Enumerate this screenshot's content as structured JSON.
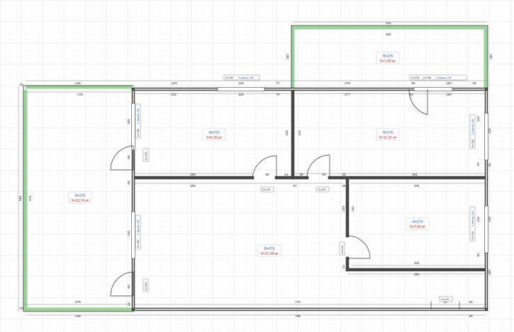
{
  "colors": {
    "grid_minor": "#eef1f5",
    "grid_major": "#d6dce6",
    "wall": "#444444",
    "exterior_wall": "#9bd49b",
    "room_height_text": "#1a5fb4",
    "room_area_text": "#c0262d"
  },
  "rooms": {
    "big_left": {
      "height": "H=270",
      "area": "S=15,74 м²"
    },
    "room_mid_top": {
      "height": "H=270",
      "area": "S=8,90 м²"
    },
    "room_right_top": {
      "height": "H=270",
      "area": "S=11,32 м²"
    },
    "room_top_annex": {
      "height": "H=270",
      "area": "S=7,40 м²"
    },
    "room_center": {
      "height": "H=270",
      "area": "S=21,08 м²"
    },
    "room_right_mid": {
      "height": "H=270",
      "area": "S=7,68 м²"
    }
  },
  "dimensions": {
    "top_total_left": "246",
    "top_left_inner": "276",
    "top_224": "224",
    "top_214": "214",
    "top_120a": "120",
    "top_120b": "120",
    "top_77": "77",
    "top_75": "75",
    "top_275": "275",
    "top_277": "277",
    "top_90": "90",
    "top_100a": "100",
    "top_100b": "100",
    "top_36": "36",
    "top_90b": "90",
    "annex_511": "511",
    "annex_491": "491",
    "annex_left": "182",
    "annex_right": "182",
    "left_outer": "581",
    "left_inner": "571",
    "mid_306a": "306",
    "mid_306b": "306",
    "mid_21": "21",
    "mid_60a": "60",
    "mid_36": "36",
    "mid_60b": "60",
    "mid_26a": "26",
    "mid_351": "351",
    "mid_67": "67",
    "mid_26b": "26",
    "v_229a": "229",
    "v_229b": "229",
    "v_100": "100",
    "v_60a": "60",
    "v_63": "63",
    "v_220a": "220",
    "v_60b": "60",
    "v_ret": "15",
    "right_v_120a": "120",
    "right_v_120b": "120",
    "right_v_87": "87",
    "right_v_93": "93",
    "right_v_120c": "120",
    "right_v_120d": "120",
    "right_v_92": "92",
    "right_v_168": "168",
    "r_341a": "341",
    "r_341b": "341",
    "r_351": "351",
    "r_143": "143",
    "r_141": "141",
    "r_13": "13",
    "bottom_276": "276",
    "bottom_774": "774",
    "bottom_246": "246",
    "bottom_789": "789",
    "bottom_60": "60",
    "bottom_52": "52",
    "bottom_60b": "60",
    "bottom_10": "10",
    "left_10": "10"
  },
  "tags": {
    "win_top_h": "H=150",
    "win_top_sub": "H рапор.=80",
    "win_top2_h": "H=150",
    "win_top2_sub": "H рапор.=80",
    "door_h225": "H=225",
    "win_left_h": "H=150",
    "win_left_sub": "H рапор.=80",
    "win_left2_h": "H=150",
    "win_left2_sub": "H рапор.=80",
    "win_right_h": "H=150",
    "win_right_sub": "H рапор.=80",
    "win_right2_h": "H=150",
    "win_right2_sub": "H рапор.=80",
    "door_l1": "H=220",
    "door_l2": "H=220",
    "door_l3": "H=220",
    "door_c1": "H=210",
    "door_c2": "H=210",
    "door_r": "H=210",
    "door_b": "H=210"
  }
}
